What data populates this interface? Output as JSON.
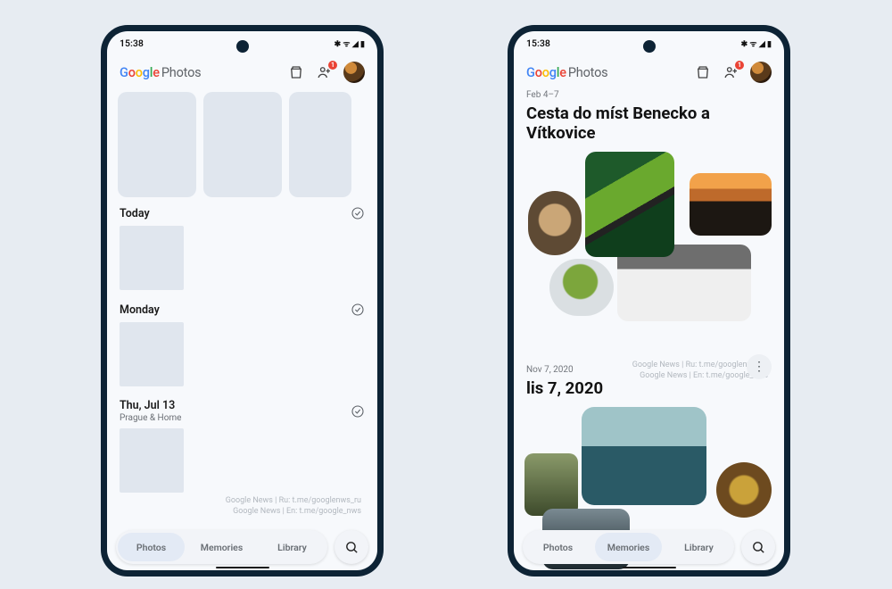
{
  "status": {
    "time": "15:38",
    "icons": "✱ ᯤ ◢ ▮"
  },
  "app": {
    "logo_letters": [
      "G",
      "o",
      "o",
      "g",
      "l",
      "e"
    ],
    "logo_suffix": "Photos",
    "share_badge": "1"
  },
  "left": {
    "groups": [
      {
        "title": "Today",
        "subtitle": ""
      },
      {
        "title": "Monday",
        "subtitle": ""
      },
      {
        "title": "Thu, Jul 13",
        "subtitle": "Prague & Home"
      }
    ],
    "credits_l1": "Google News | Ru: t.me/googlenws_ru",
    "credits_l2": "Google News | En: t.me/google_nws",
    "tabs": {
      "photos": "Photos",
      "memories": "Memories",
      "library": "Library",
      "active": "photos"
    }
  },
  "right": {
    "memory1": {
      "date": "Feb 4–7",
      "title": "Cesta do míst Benecko a Vítkovice"
    },
    "credits_l1": "Google News | Ru: t.me/googlenws_ru",
    "credits_l2": "Google News | En: t.me/google_nws",
    "memory2": {
      "date": "Nov 7, 2020",
      "title": "lis 7, 2020"
    },
    "tabs": {
      "photos": "Photos",
      "memories": "Memories",
      "library": "Library",
      "active": "memories"
    }
  }
}
